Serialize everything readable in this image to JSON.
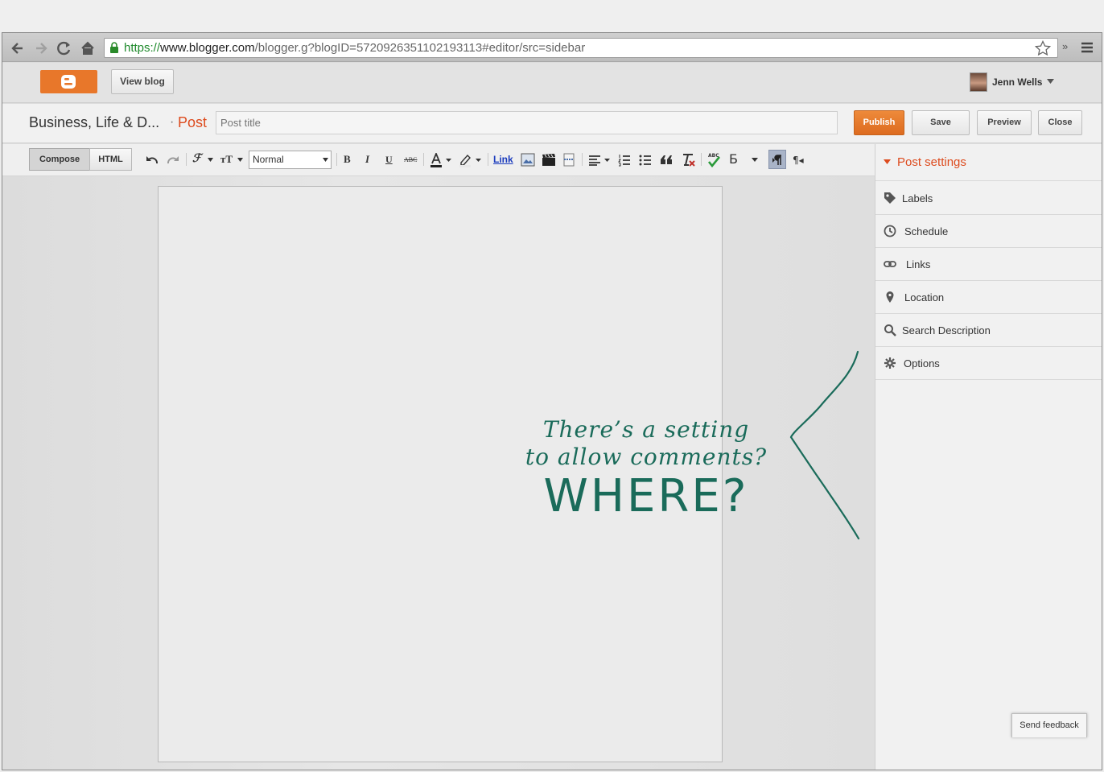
{
  "browser": {
    "url_https": "https://",
    "url_domain": "www.blogger.com",
    "url_path": "/blogger.g?blogID=5720926351102193113#editor/src=sidebar",
    "menu_more": "»"
  },
  "appbar": {
    "view_blog_label": "View blog",
    "user_name": "Jenn Wells"
  },
  "titlebar": {
    "blog_name": "Business, Life & D...",
    "separator": "·",
    "post_label": "Post",
    "post_title_placeholder": "Post title",
    "publish_label": "Publish",
    "save_label": "Save",
    "preview_label": "Preview",
    "close_label": "Close"
  },
  "toolbar": {
    "compose_label": "Compose",
    "html_label": "HTML",
    "format_value": "Normal",
    "link_label": "Link",
    "bold": "B",
    "italic": "I",
    "underline": "U",
    "strike": "ABC",
    "font_family": "ℱ",
    "font_size": "тT",
    "cyrillic": "Б",
    "rtl": "¶◂"
  },
  "annotation": {
    "line1": "There’s a setting",
    "line2": "to allow comments?",
    "line3": "WHERE?"
  },
  "sidebar": {
    "header": "Post settings",
    "items": [
      {
        "label": "Labels",
        "icon": "tag-icon"
      },
      {
        "label": "Schedule",
        "icon": "clock-icon"
      },
      {
        "label": "Links",
        "icon": "link-icon"
      },
      {
        "label": "Location",
        "icon": "pin-icon"
      },
      {
        "label": "Search Description",
        "icon": "search-icon"
      },
      {
        "label": "Options",
        "icon": "gear-icon"
      }
    ]
  },
  "feedback_label": "Send feedback",
  "colors": {
    "accent_orange": "#dd4b1e",
    "publish_orange": "#e8772a",
    "annotation_green": "#1a6b5a"
  }
}
